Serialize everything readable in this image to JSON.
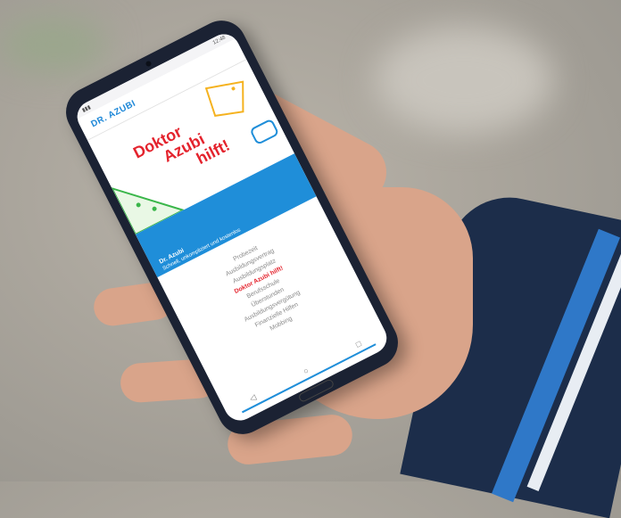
{
  "status_bar": {
    "time": "12:48"
  },
  "app": {
    "title": "DR. AZUBI"
  },
  "hero": {
    "line1": "Doktor",
    "line2": "Azubi",
    "line3": "hilft!"
  },
  "banner": {
    "title": "Dr. Azubi",
    "description": "Schnell, unkompliziert und kostenlos"
  },
  "menu": {
    "items": [
      "Probezeit",
      "Ausbildungsvertrag",
      "Ausbildungsplatz",
      "Doktor Azubi hilft!",
      "Berufsschule",
      "Überstunden",
      "Ausbildungsvergütung",
      "Finanzielle Hilfen",
      "Mobbing"
    ],
    "active_index": 3
  },
  "colors": {
    "brand_blue": "#1f8ed9",
    "brand_red": "#e4232d",
    "phone_body": "#1b2233",
    "sleeve": "#1c2d4a"
  },
  "icons": [
    "back-icon",
    "home-icon",
    "recents-icon"
  ]
}
